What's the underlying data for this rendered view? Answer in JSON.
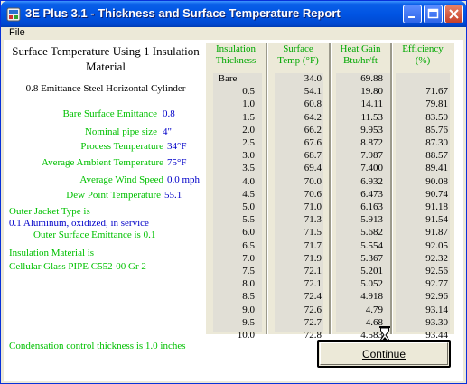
{
  "window": {
    "title": "3E Plus 3.1 - Thickness and Surface Temperature Report",
    "menu": [
      "File"
    ]
  },
  "report": {
    "heading": "Surface Temperature Using 1 Insulation Material",
    "subheading": "0.8 Emittance Steel Horizontal Cylinder",
    "params": [
      {
        "label": "Bare Surface Emittance",
        "value": "0.8"
      },
      {
        "label": "Nominal pipe size",
        "value": "4\""
      },
      {
        "label": "Process Temperature",
        "value": "34°F"
      },
      {
        "label": "Average Ambient Temperature",
        "value": "75°F"
      },
      {
        "label": "Average Wind Speed",
        "value": "0.0 mph"
      },
      {
        "label": "Dew Point Temperature",
        "value": "55.1"
      }
    ],
    "jacket_label": "Outer Jacket Type is",
    "jacket_value": "0.1  Aluminum, oxidized, in service",
    "jacket_emittance": "Outer Surface Emittance is 0.1",
    "insulation_label": "Insulation Material is",
    "insulation_value": "Cellular Glass PIPE C552-00 Gr 2",
    "condensation_note": "Condensation control thickness is 1.0 inches"
  },
  "table": {
    "headers": [
      {
        "line1": "Insulation",
        "line2": "Thickness"
      },
      {
        "line1": "Surface",
        "line2": "Temp (°F)"
      },
      {
        "line1": "Heat Gain",
        "line2": "Btu/hr/ft"
      },
      {
        "line1": "Efficiency",
        "line2": "(%)"
      }
    ],
    "rows": [
      [
        "Bare",
        "34.0",
        "69.88",
        ""
      ],
      [
        "0.5",
        "54.1",
        "19.80",
        "71.67"
      ],
      [
        "1.0",
        "60.8",
        "14.11",
        "79.81"
      ],
      [
        "1.5",
        "64.2",
        "11.53",
        "83.50"
      ],
      [
        "2.0",
        "66.2",
        "9.953",
        "85.76"
      ],
      [
        "2.5",
        "67.6",
        "8.872",
        "87.30"
      ],
      [
        "3.0",
        "68.7",
        "7.987",
        "88.57"
      ],
      [
        "3.5",
        "69.4",
        "7.400",
        "89.41"
      ],
      [
        "4.0",
        "70.0",
        "6.932",
        "90.08"
      ],
      [
        "4.5",
        "70.6",
        "6.473",
        "90.74"
      ],
      [
        "5.0",
        "71.0",
        "6.163",
        "91.18"
      ],
      [
        "5.5",
        "71.3",
        "5.913",
        "91.54"
      ],
      [
        "6.0",
        "71.5",
        "5.682",
        "91.87"
      ],
      [
        "6.5",
        "71.7",
        "5.554",
        "92.05"
      ],
      [
        "7.0",
        "71.9",
        "5.367",
        "92.32"
      ],
      [
        "7.5",
        "72.1",
        "5.201",
        "92.56"
      ],
      [
        "8.0",
        "72.1",
        "5.052",
        "92.77"
      ],
      [
        "8.5",
        "72.4",
        "4.918",
        "92.96"
      ],
      [
        "9.0",
        "72.6",
        "4.79",
        "93.14"
      ],
      [
        "9.5",
        "72.7",
        "4.68",
        "93.30"
      ],
      [
        "10.0",
        "72.8",
        "4.583",
        "93.44"
      ]
    ]
  },
  "buttons": {
    "continue": "Continue"
  },
  "icons": {
    "app": "app-icon",
    "minimize": "minimize-icon",
    "maximize": "maximize-icon",
    "close": "close-icon",
    "cursor": "hourglass-cursor-icon"
  }
}
